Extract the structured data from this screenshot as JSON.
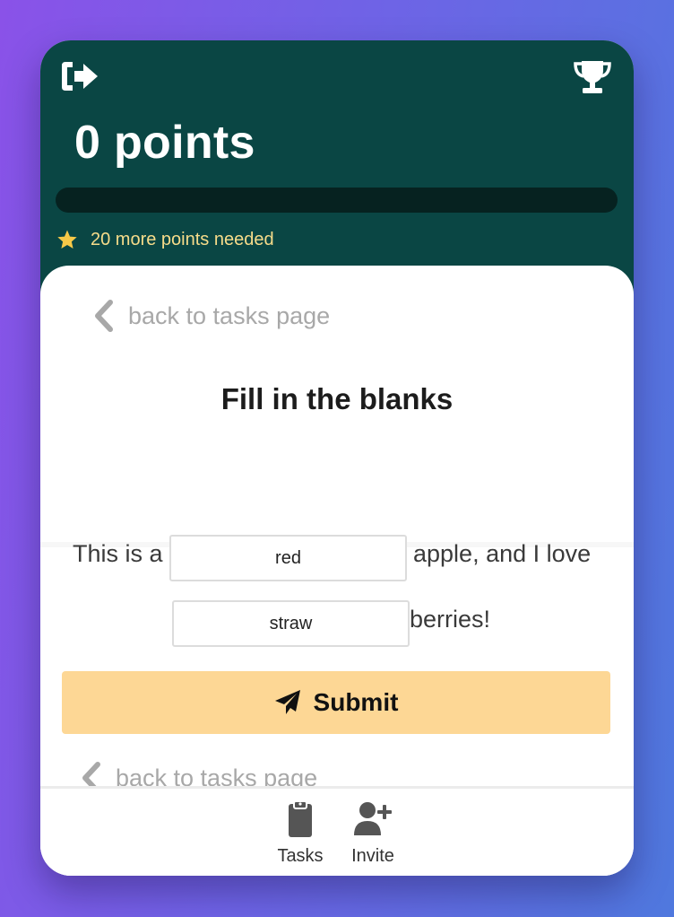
{
  "header": {
    "points_title": "0 points",
    "progress_fraction": 0,
    "points_needed_text": "20 more points needed",
    "logout_icon": "logout-icon",
    "trophy_icon": "trophy-icon",
    "background": "#0a4644",
    "star_color": "#f7c948"
  },
  "content": {
    "back_link_label": "back to tasks page",
    "heading": "Fill in the blanks",
    "sentence": {
      "part1": "This is a",
      "blank1_value": "red",
      "part2": "apple, and I love",
      "blank2_value": "straw",
      "part3": "berries!"
    },
    "submit_label": "Submit",
    "submit_icon": "paper-plane-icon",
    "submit_color": "#fdd795"
  },
  "bottom_nav": {
    "items": [
      {
        "label": "Tasks",
        "icon": "clipboard-icon"
      },
      {
        "label": "Invite",
        "icon": "user-plus-icon"
      }
    ]
  }
}
